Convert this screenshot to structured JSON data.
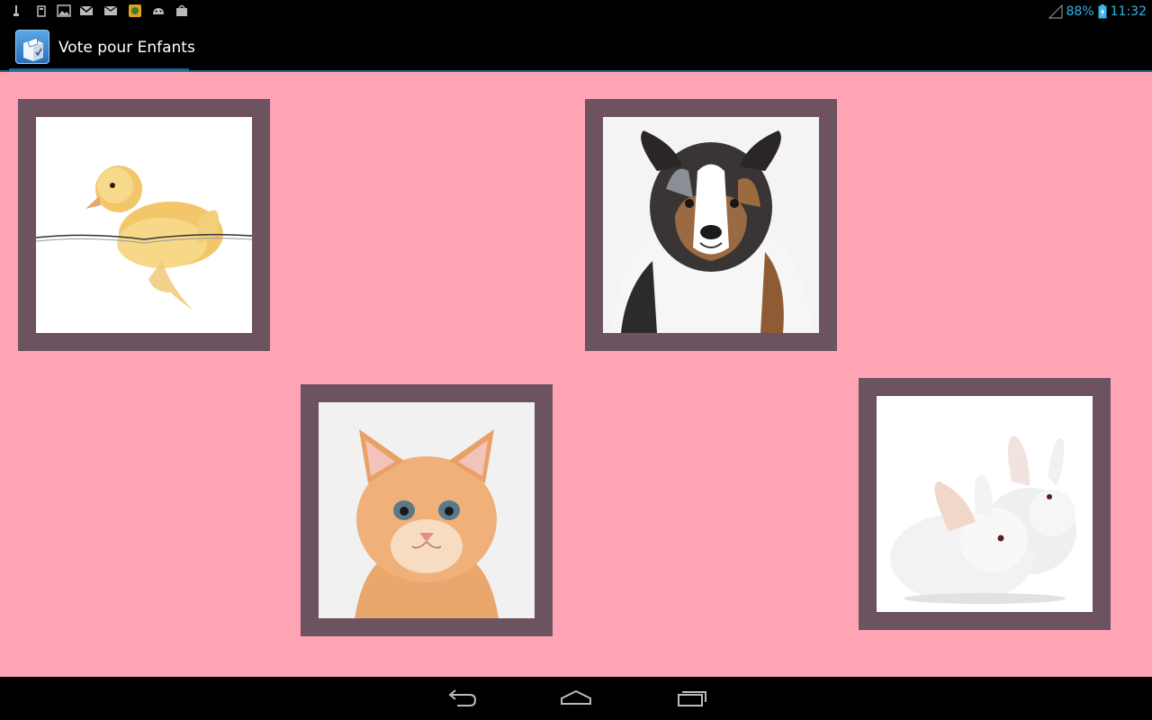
{
  "status_bar": {
    "left_icons": [
      "usb-debug-icon",
      "sd-card-icon",
      "gallery-icon",
      "gmail-icon",
      "email-icon",
      "app-update-icon",
      "android-icon",
      "store-icon"
    ],
    "battery": "88%",
    "time": "11:32"
  },
  "action_bar": {
    "title": "Vote pour Enfants"
  },
  "animals": [
    {
      "name": "duckling",
      "label": "duckling-photo"
    },
    {
      "name": "dog",
      "label": "dog-photo"
    },
    {
      "name": "kitten",
      "label": "kitten-photo"
    },
    {
      "name": "bunnies",
      "label": "bunnies-photo"
    }
  ],
  "colors": {
    "background": "#ffa4b4",
    "frame": "#6d5360",
    "accent": "#33b5e5"
  },
  "nav_bar": {
    "buttons": [
      "back-icon",
      "home-icon",
      "recent-apps-icon"
    ]
  }
}
